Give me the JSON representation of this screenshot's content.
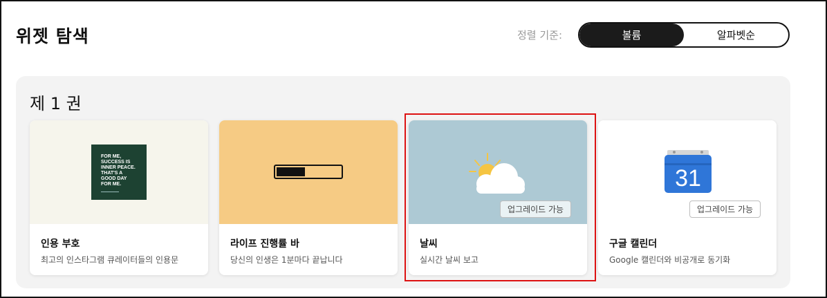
{
  "page": {
    "title": "위젯 탐색"
  },
  "sort": {
    "label": "정렬 기준:",
    "options": [
      "볼륨",
      "알파벳순"
    ],
    "selected": "볼륨"
  },
  "section": {
    "title": "제 1 권"
  },
  "cards": [
    {
      "title": "인용 부호",
      "description": "최고의 인스타그램 큐레이터들의 인용문",
      "preview_bg": "#f6f5ec",
      "quote_lines": [
        "FOR ME,",
        "SUCCESS IS",
        "INNER PEACE.",
        "THAT'S A",
        "GOOD DAY",
        "FOR ME."
      ],
      "icon": "quote-image"
    },
    {
      "title": "라이프 진행률 바",
      "description": "당신의 인생은 1분마다 끝납니다",
      "preview_bg": "#f6cb84",
      "progress_fraction": 0.45,
      "icon": "progress-bar"
    },
    {
      "title": "날씨",
      "description": "실시간 날씨 보고",
      "preview_bg": "#adc9d4",
      "badge": "업그레이드 가능",
      "icon": "partly-cloudy-icon"
    },
    {
      "title": "구글 캘린더",
      "description": "Google 캘린더와 비공개로 동기화",
      "preview_bg": "#ffffff",
      "badge": "업그레이드 가능",
      "calendar_number": "31",
      "icon": "google-calendar-icon"
    }
  ],
  "colors": {
    "selected_outline": "#dd1111",
    "calendar_blue": "#2f76d8",
    "sun": "#f5c542"
  }
}
